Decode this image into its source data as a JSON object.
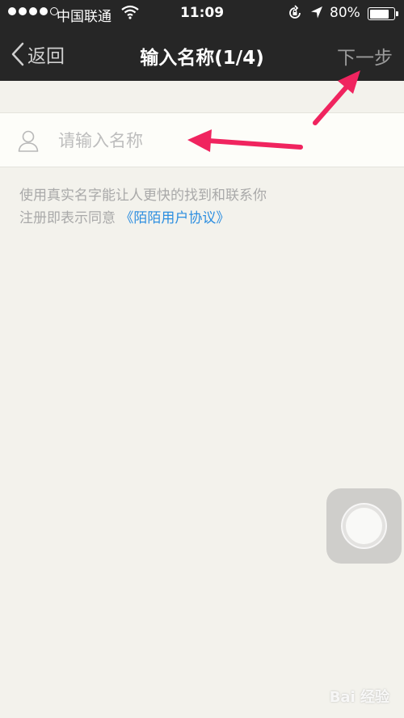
{
  "status_bar": {
    "carrier": "中国联通",
    "time": "11:09",
    "battery_percent": "80%",
    "battery_level": 0.8,
    "signal_strength": 4,
    "icons": [
      "signal-dots-icon",
      "wifi-icon",
      "rotation-lock-icon",
      "location-arrow-icon",
      "battery-icon"
    ]
  },
  "nav": {
    "back_label": "返回",
    "title": "输入名称(1/4)",
    "next_label": "下一步"
  },
  "name_field": {
    "placeholder": "请输入名称",
    "value": "",
    "icon": "user-icon"
  },
  "hint": {
    "line1": "使用真实名字能让人更快的找到和联系你",
    "line2_prefix": "注册即表示同意 ",
    "agreement_link": "《陌陌用户协议》"
  },
  "assistive_touch": {
    "icon": "assistive-touch-icon"
  },
  "annotations": {
    "color": "#f0245f"
  },
  "watermark": {
    "text": "Bai 经验"
  },
  "colors": {
    "nav_background": "#262626",
    "page_background": "#f3f2ec",
    "link": "#2c8ee0",
    "annotation_arrow": "#f0245f"
  }
}
